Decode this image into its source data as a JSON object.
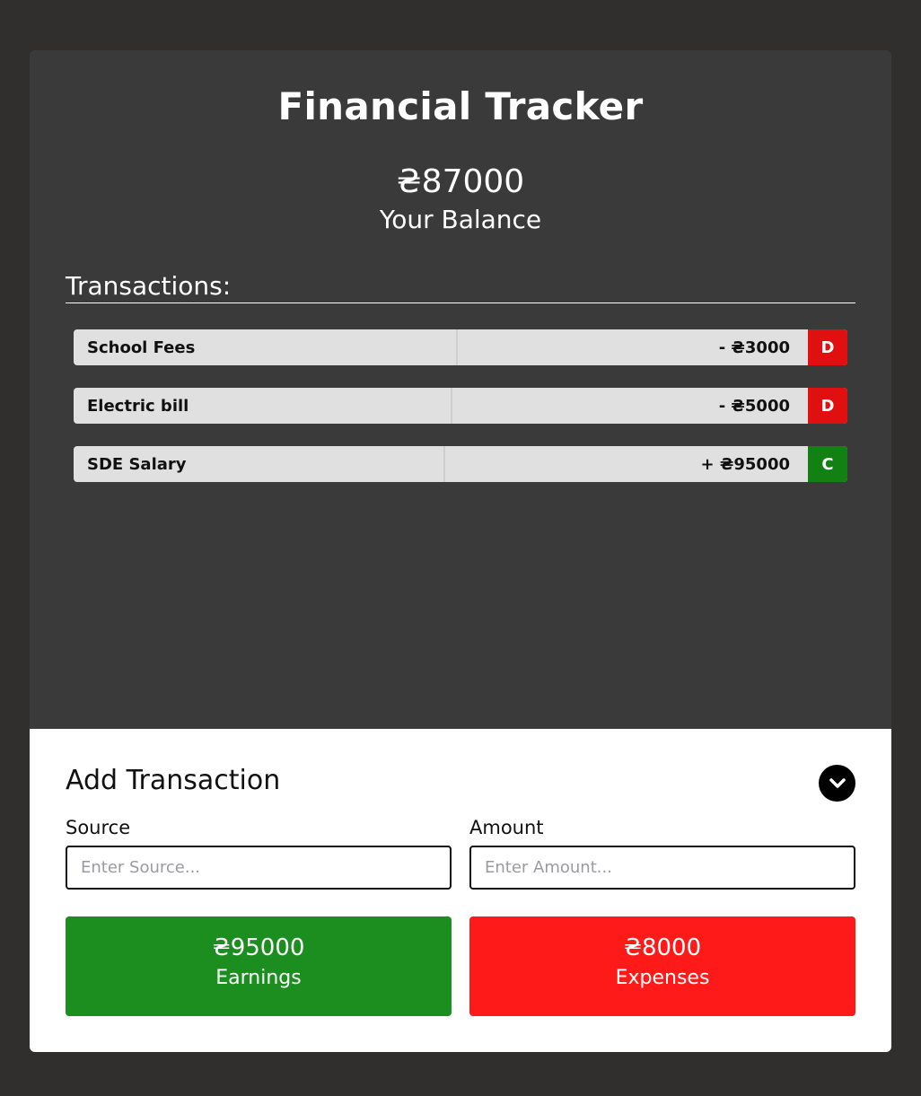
{
  "app": {
    "title": "Financial Tracker",
    "balance": "₴87000",
    "balance_label": "Your Balance"
  },
  "transactions": {
    "heading": "Transactions:",
    "items": [
      {
        "source": "School Fees",
        "amount": "- ₴3000",
        "type": "D",
        "kind": "debit"
      },
      {
        "source": "Electric bill",
        "amount": "- ₴5000",
        "type": "D",
        "kind": "debit"
      },
      {
        "source": "SDE Salary",
        "amount": "+ ₴95000",
        "type": "C",
        "kind": "credit"
      }
    ]
  },
  "add_form": {
    "title": "Add Transaction",
    "toggle_icon": "chevron-down-icon",
    "source_label": "Source",
    "source_placeholder": "Enter Source...",
    "source_value": "",
    "amount_label": "Amount",
    "amount_placeholder": "Enter Amount...",
    "amount_value": ""
  },
  "summary": {
    "earnings_amount": "₴95000",
    "earnings_label": "Earnings",
    "expenses_amount": "₴8000",
    "expenses_label": "Expenses"
  },
  "colors": {
    "background": "#302f2d",
    "panel": "#3a3a3a",
    "debit": "#e01010",
    "credit": "#128012",
    "earnings": "#1b8e1f",
    "expenses": "#ff1a1a"
  }
}
